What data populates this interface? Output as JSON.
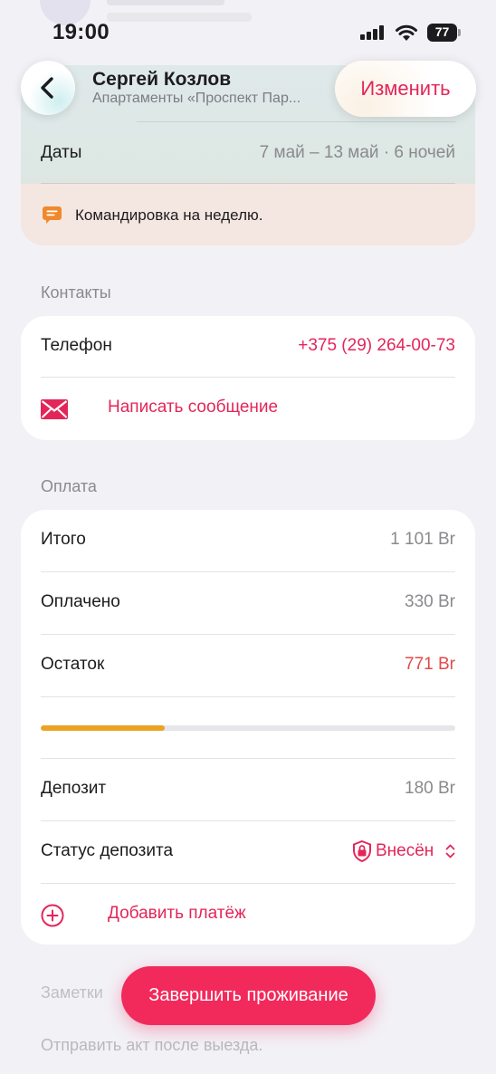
{
  "status_bar": {
    "time": "19:00",
    "battery": "77"
  },
  "header": {
    "title": "Сергей Козлов",
    "subtitle": "Апартаменты «Проспект Пар...",
    "edit_label": "Изменить"
  },
  "booking": {
    "dates_label": "Даты",
    "dates_value": "7 май – 13 май · 6 ночей",
    "note": "Командировка на неделю."
  },
  "contacts": {
    "section_title": "Контакты",
    "phone_label": "Телефон",
    "phone_value": "+375 (29) 264-00-73",
    "message_label": "Написать сообщение"
  },
  "payment": {
    "section_title": "Оплата",
    "total_label": "Итого",
    "total_value": "1 101 Br",
    "paid_label": "Оплачено",
    "paid_value": "330 Br",
    "remaining_label": "Остаток",
    "remaining_value": "771 Br",
    "paid_fraction": 0.3,
    "deposit_label": "Депозит",
    "deposit_value": "180 Br",
    "deposit_status_label": "Статус депозита",
    "deposit_status_value": "Внесён",
    "add_payment_label": "Добавить платёж"
  },
  "notes": {
    "section_title": "Заметки",
    "text": "Отправить акт после выезда."
  },
  "finish_label": "Завершить проживание",
  "colors": {
    "accent": "#e3265a",
    "progress": "#eaa325",
    "remaining": "#e24a4a"
  }
}
